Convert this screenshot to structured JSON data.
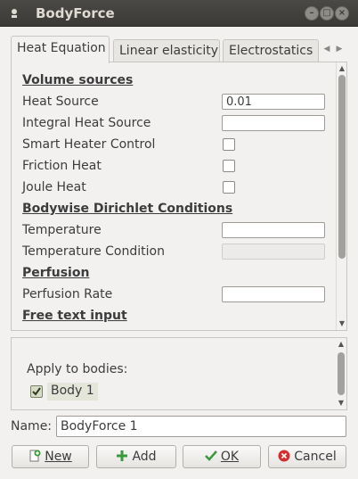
{
  "window": {
    "title": "BodyForce"
  },
  "tabs": [
    {
      "label": "Heat Equation",
      "active": true
    },
    {
      "label": "Linear elasticity",
      "active": false
    },
    {
      "label": "Electrostatics",
      "active": false
    }
  ],
  "form": {
    "volume_sources": "Volume sources",
    "heat_source_label": "Heat Source",
    "heat_source_value": "0.01",
    "integral_heat_source_label": "Integral Heat Source",
    "integral_heat_source_value": "",
    "smart_heater_label": "Smart Heater Control",
    "friction_heat_label": "Friction Heat",
    "joule_heat_label": "Joule Heat",
    "dirichlet_heading": "Bodywise Dirichlet Conditions",
    "temperature_label": "Temperature",
    "temperature_value": "",
    "temperature_condition_label": "Temperature Condition",
    "perfusion_heading": "Perfusion",
    "perfusion_rate_label": "Perfusion Rate",
    "perfusion_rate_value": "",
    "free_text_heading": "Free text input"
  },
  "bodies": {
    "apply_label": "Apply to bodies:",
    "items": [
      {
        "label": "Body 1",
        "checked": true
      }
    ]
  },
  "name": {
    "label": "Name:",
    "value": "BodyForce 1"
  },
  "buttons": {
    "new_label": "New",
    "add_label": "Add",
    "ok_label": "OK",
    "cancel_label": "Cancel"
  },
  "colors": {
    "titlebar": "#3c3b37",
    "add_icon": "#3a9a3a",
    "cancel_icon": "#d32f2f",
    "ok_icon": "#3a9a3a"
  },
  "icons": [
    "window-icon",
    "minimize-icon",
    "maximize-icon",
    "close-icon",
    "new-document-icon",
    "plus-icon",
    "checkmark-icon",
    "cancel-icon"
  ]
}
